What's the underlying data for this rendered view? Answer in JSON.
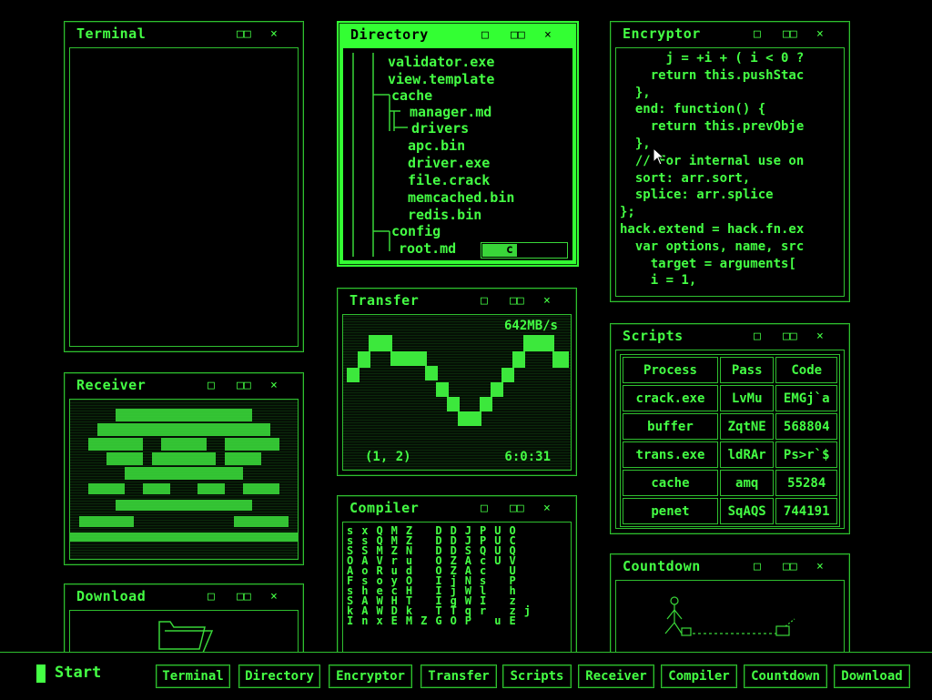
{
  "windows": {
    "terminal": {
      "title": "Terminal",
      "controls": [
        "□□",
        "×"
      ]
    },
    "directory": {
      "title": "Directory",
      "controls": [
        "□",
        "□□",
        "×"
      ],
      "items": [
        "validator.exe",
        "view.template",
        "cache",
        "manager.md",
        "drivers",
        "apc.bin",
        "driver.exe",
        "file.crack",
        "memcached.bin",
        "redis.bin",
        "config",
        "root.md"
      ],
      "progress_text": "c"
    },
    "encryptor": {
      "title": "Encryptor",
      "controls": [
        "□",
        "□□",
        "×"
      ],
      "lines": [
        "      j = +i + ( i < 0 ?",
        "    return this.pushStac",
        "  },",
        "  end: function() {",
        "    return this.prevObje",
        "  },",
        "  // For internal use on",
        "  sort: arr.sort,",
        "  splice: arr.splice",
        "};",
        "hack.extend = hack.fn.ex",
        "  var options, name, src",
        "    target = arguments[",
        "    i = 1,"
      ]
    },
    "transfer": {
      "title": "Transfer",
      "controls": [
        "□",
        "□□",
        "×"
      ],
      "rate": "642MB/s",
      "coords": "(1, 2)",
      "time": "6:0:31"
    },
    "receiver": {
      "title": "Receiver",
      "controls": [
        "□",
        "□□",
        "×"
      ]
    },
    "scripts": {
      "title": "Scripts",
      "controls": [
        "□",
        "□□",
        "×"
      ],
      "headers": [
        "Process",
        "Pass",
        "Code"
      ],
      "rows": [
        [
          "crack.exe",
          "LvMu",
          "EMGj`a"
        ],
        [
          "buffer",
          "ZqtNE",
          "568804"
        ],
        [
          "trans.exe",
          "ldRAr",
          "Ps>r`$"
        ],
        [
          "cache",
          "amq",
          "55284"
        ],
        [
          "penet",
          "SqAQS",
          "744191"
        ]
      ]
    },
    "compiler": {
      "title": "Compiler",
      "controls": [
        "□",
        "□□",
        "×"
      ],
      "rows": [
        "sxQMZ DDJPUO",
        "ssQMZ DDJPUC",
        "SSMZN DDSQUQ",
        "OAVru OZAcUV",
        "AoRud OZAc U",
        "FsoyO IjNs P",
        "shecH IjWl h",
        "SAWHT IgWI z",
        "kAWDk TTqr zj",
        "InxEMZGOP uE"
      ]
    },
    "countdown": {
      "title": "Countdown",
      "controls": [
        "□",
        "□□",
        "×"
      ]
    },
    "download": {
      "title": "Download",
      "controls": [
        "□",
        "□□",
        "×"
      ]
    }
  },
  "taskbar": {
    "start": "Start",
    "buttons": [
      "Terminal",
      "Directory",
      "Encryptor",
      "Transfer",
      "Scripts",
      "Receiver",
      "Compiler",
      "Countdown",
      "Download"
    ]
  },
  "colors": {
    "accent": "#33ff33",
    "dim": "#2fbf2f",
    "bg": "#000000"
  }
}
